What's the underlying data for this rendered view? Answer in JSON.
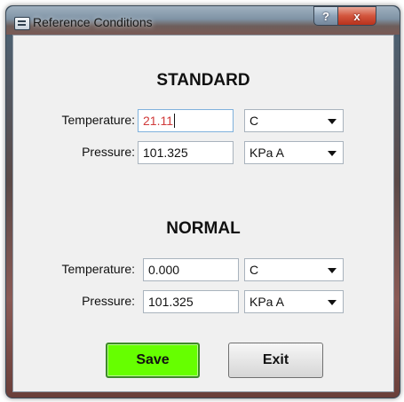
{
  "window": {
    "title": "Reference Conditions",
    "help_glyph": "?",
    "close_glyph": "x"
  },
  "standard": {
    "heading": "STANDARD",
    "temperature_label": "Temperature:",
    "temperature_value": "21.11",
    "temperature_unit": "C",
    "pressure_label": "Pressure:",
    "pressure_value": "101.325",
    "pressure_unit": "KPa A"
  },
  "normal": {
    "heading": "NORMAL",
    "temperature_label": "Temperature:",
    "temperature_value": "0.000",
    "temperature_unit": "C",
    "pressure_label": "Pressure:",
    "pressure_value": "101.325",
    "pressure_unit": "KPa A"
  },
  "buttons": {
    "save_label": "Save",
    "exit_label": "Exit"
  },
  "colors": {
    "save_button": "#66ff00",
    "active_input_text": "#d03a3a"
  }
}
